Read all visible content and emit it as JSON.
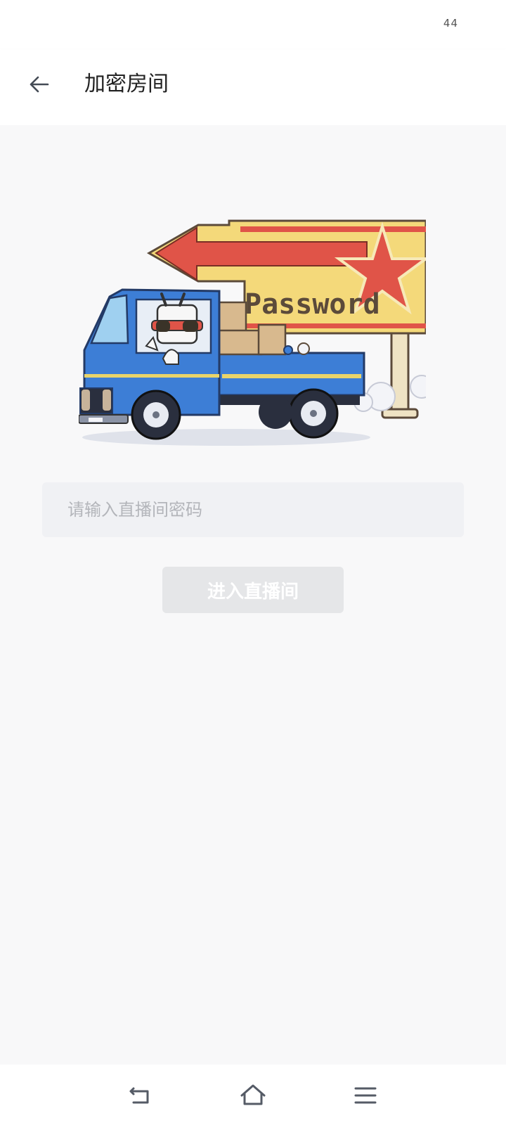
{
  "status_bar": {
    "time": "44"
  },
  "header": {
    "title": "加密房间",
    "back_icon": "arrow-left-icon"
  },
  "illustration": {
    "sign_text": "Password"
  },
  "form": {
    "password_placeholder": "请输入直播间密码",
    "password_value": "",
    "enter_button_label": "进入直播间"
  },
  "nav_bar": {
    "back_icon": "nav-back-icon",
    "home_icon": "nav-home-icon",
    "menu_icon": "nav-menu-icon"
  },
  "colors": {
    "background": "#f8f8f9",
    "input_bg": "#f0f1f4",
    "button_disabled": "#e5e6e8",
    "truck_blue": "#3d7ed6",
    "sign_yellow": "#f4d97a",
    "arrow_red": "#e05448"
  }
}
